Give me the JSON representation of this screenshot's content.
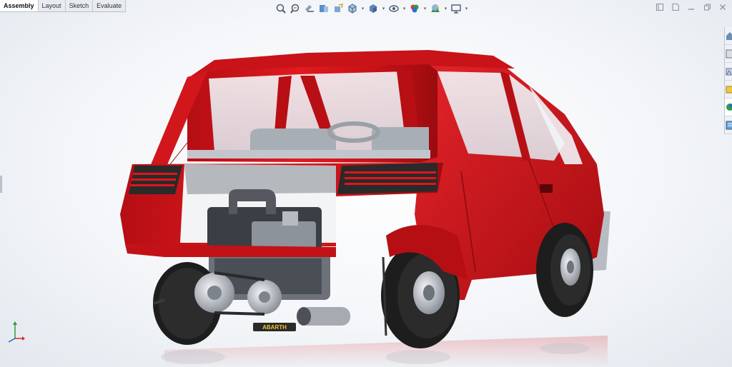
{
  "tabs": [
    {
      "label": "Assembly",
      "active": true
    },
    {
      "label": "Layout",
      "active": false
    },
    {
      "label": "Sketch",
      "active": false
    },
    {
      "label": "Evaluate",
      "active": false
    }
  ],
  "toolbar": {
    "icons": [
      "zoom-to-fit-icon",
      "zoom-to-area-icon",
      "previous-view-icon",
      "section-view-icon",
      "dynamic-annotation-icon",
      "view-orientation-icon",
      "display-style-icon",
      "hide-show-items-icon",
      "edit-appearance-icon",
      "apply-scene-icon",
      "view-settings-icon"
    ]
  },
  "window_controls": [
    "restore-pane-icon",
    "new-window-icon",
    "minimize-icon",
    "close-icon"
  ],
  "task_pane": [
    "home-icon",
    "resources-icon",
    "design-library-icon",
    "file-explorer-icon",
    "appearances-icon",
    "custom-properties-icon"
  ],
  "model": {
    "badge_text": "ABARTH",
    "body_color": "#d8141a",
    "shadow_color": "#9e0d10",
    "tyre_color": "#1d1d1d",
    "metal_color": "#c9ccd1"
  }
}
